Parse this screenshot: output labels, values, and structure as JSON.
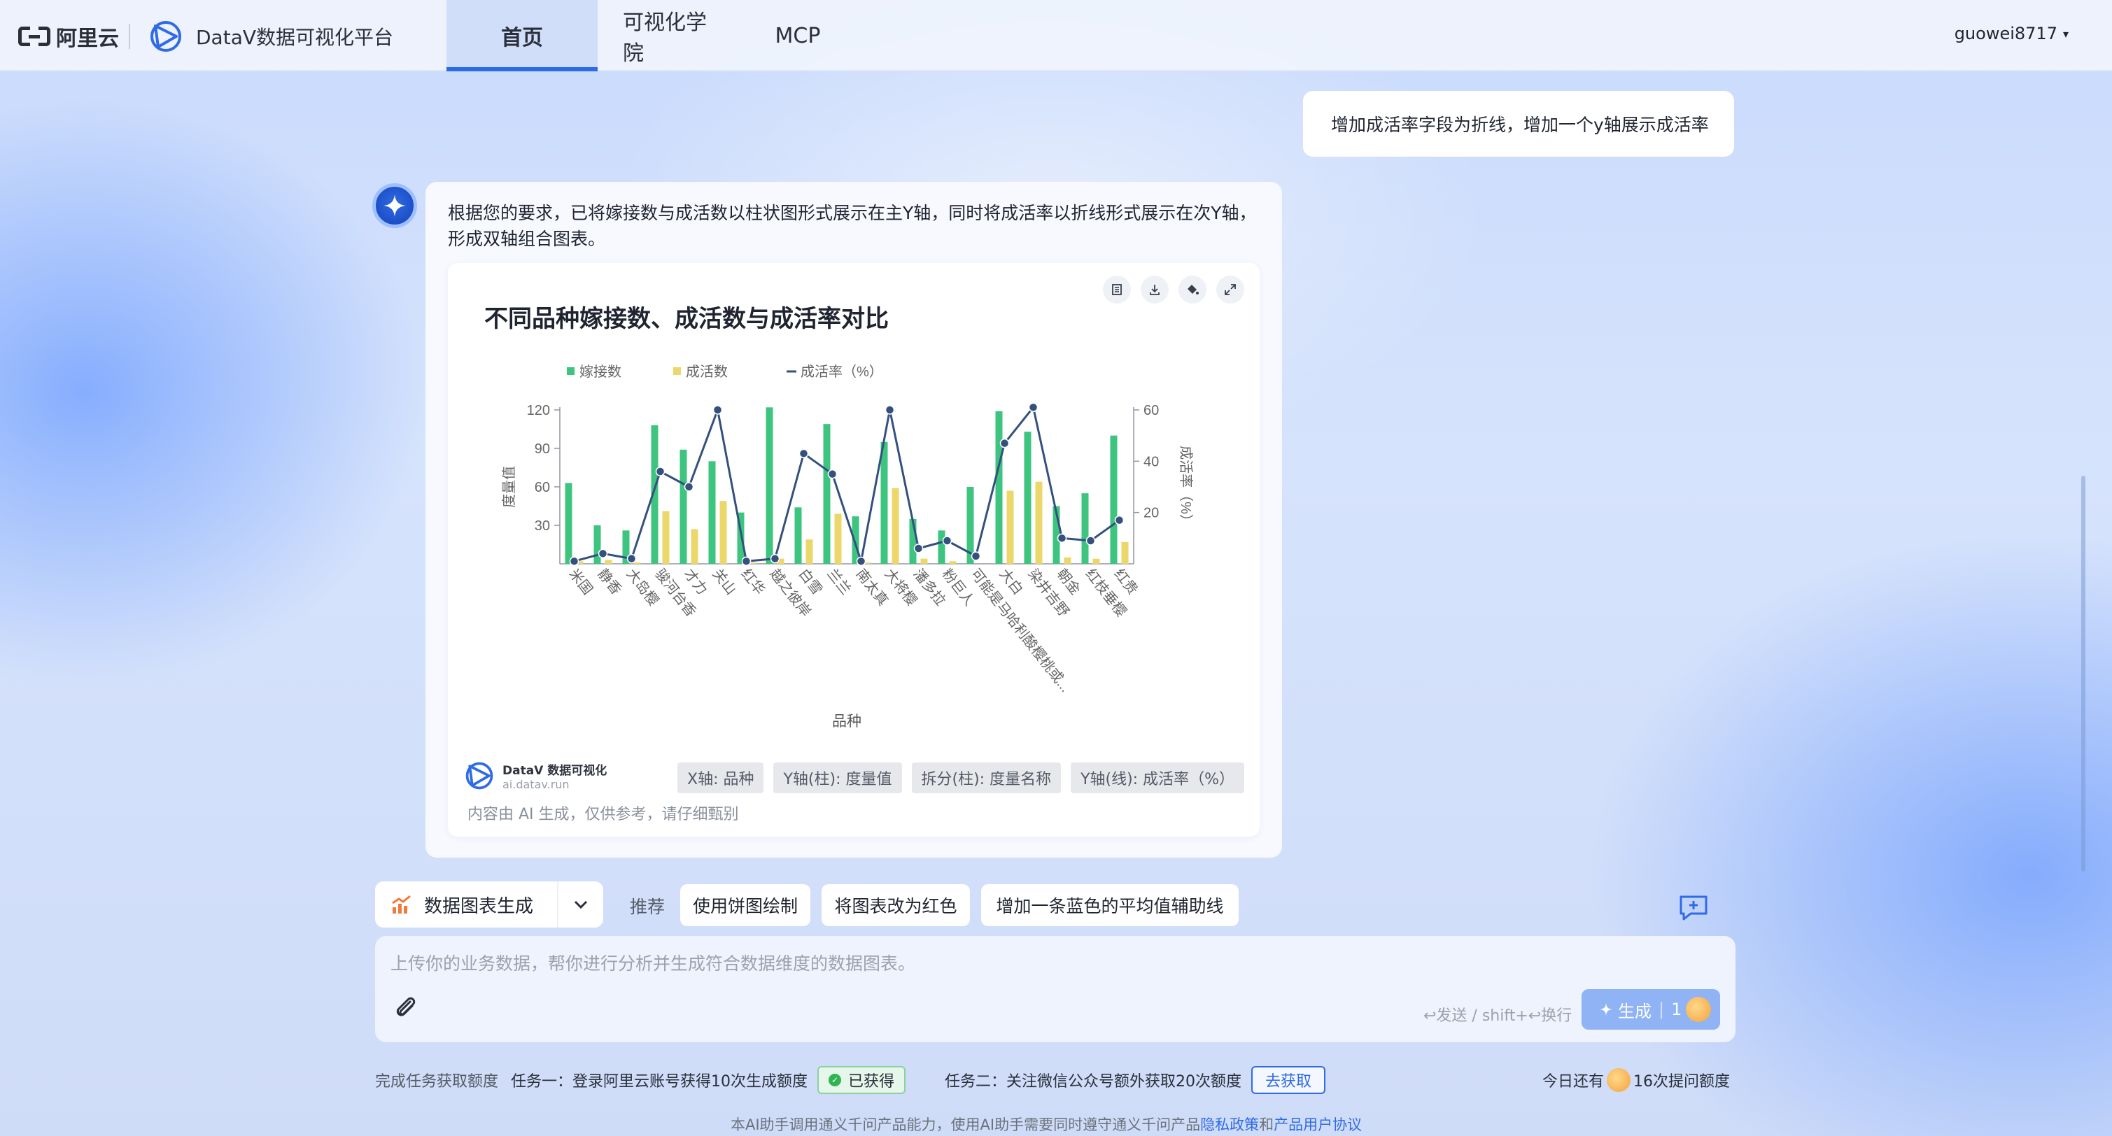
{
  "topbar": {
    "aliyun_logo": "阿里云",
    "brand": "DataV数据可视化平台",
    "tabs": [
      "首页",
      "可视化学院",
      "MCP"
    ],
    "active_tab": "首页",
    "user": "guowei8717",
    "user_caret": "▾"
  },
  "chat": {
    "user_message": "增加成活率字段为折线，增加一个y轴展示成活率",
    "ai_message": "根据您的要求，已将嫁接数与成活数以柱状图形式展示在主Y轴，同时将成活率以折线形式展示在次Y轴，形成双轴组合图表。"
  },
  "chart_card": {
    "tools": [
      "table-icon",
      "download-icon",
      "paint-bucket-icon",
      "fullscreen-icon"
    ],
    "footer_brand": "DataV 数据可视化",
    "footer_url": "ai.datav.run",
    "tags": [
      "X轴: 品种",
      "Y轴(柱): 度量值",
      "拆分(柱): 度量名称",
      "Y轴(线): 成活率（%）"
    ],
    "disclaimer": "内容由 AI 生成，仅供参考，请仔细甄别"
  },
  "chart_data": {
    "type": "bar",
    "title": "不同品种嫁接数、成活数与成活率对比",
    "xlabel": "品种",
    "ylabel": "度量值",
    "ylabel_right": "成活率（%）",
    "ylim": [
      0,
      120
    ],
    "yticks": [
      30,
      60,
      90,
      120
    ],
    "ylim_right": [
      0,
      60
    ],
    "yticks_right": [
      20,
      40,
      60
    ],
    "legend_position": "top",
    "colors": {
      "graft": "#3dc47e",
      "survive": "#ecd76a",
      "rate": "#34507e"
    },
    "categories": [
      "米国",
      "静香",
      "大岛樱",
      "骏河台香",
      "才力",
      "关山",
      "红华",
      "越之彼岸",
      "白雪",
      "兰兰",
      "南太真",
      "大将樱",
      "潘多拉",
      "粉巨人",
      "可能是马哈利酸樱桃或...",
      "大白",
      "染井吉野",
      "朝金",
      "红枝垂樱",
      "红贵"
    ],
    "series": [
      {
        "name": "嫁接数",
        "kind": "bar",
        "axis": "left",
        "values": [
          63,
          30,
          26,
          108,
          89,
          80,
          40,
          122,
          44,
          109,
          37,
          95,
          35,
          26,
          60,
          119,
          103,
          45,
          55,
          100
        ]
      },
      {
        "name": "成活数",
        "kind": "bar",
        "axis": "left",
        "values": [
          2,
          3,
          1,
          41,
          27,
          49,
          1,
          4,
          19,
          39,
          1,
          59,
          4,
          2,
          0,
          57,
          64,
          5,
          4,
          17
        ]
      },
      {
        "name": "成活率（%）",
        "kind": "line",
        "axis": "right",
        "values": [
          1,
          4,
          2,
          36,
          30,
          60,
          1,
          2,
          43,
          35,
          1,
          60,
          6,
          9,
          3,
          47,
          61,
          10,
          9,
          17
        ]
      }
    ]
  },
  "composer": {
    "mode_label": "数据图表生成",
    "recommend_label": "推荐",
    "suggestions": [
      "使用饼图绘制",
      "将图表改为红色",
      "增加一条蓝色的平均值辅助线"
    ],
    "placeholder": "上传你的业务数据，帮你进行分析并生成符合数据维度的数据图表。",
    "hint": "↩发送 / shift+↩换行",
    "generate_label": "生成",
    "generate_cost": "1"
  },
  "tasks": {
    "intro": "完成任务获取额度",
    "task1": "任务一：登录阿里云账号获得10次生成额度",
    "task1_status": "已获得",
    "task2": "任务二：关注微信公众号额外获取20次额度",
    "task2_action": "去获取",
    "quota_prefix": "今日还有",
    "quota_suffix": "16次提问额度"
  },
  "footer": {
    "note": "本AI助手调用通义千问产品能力，使用AI助手需要同时遵守通义千问产品",
    "privacy": "隐私政策",
    "and": "和",
    "agreement": "产品用户协议"
  }
}
